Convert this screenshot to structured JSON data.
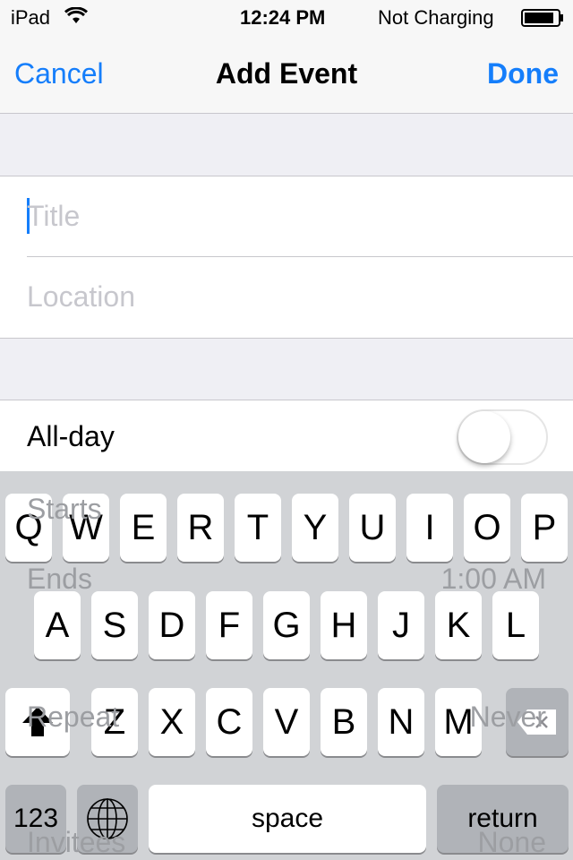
{
  "status": {
    "device": "iPad",
    "time": "12:24 PM",
    "battery": "Not Charging",
    "icons": [
      "wifi-icon",
      "battery-icon"
    ]
  },
  "nav": {
    "cancel": "Cancel",
    "title": "Add Event",
    "done": "Done"
  },
  "form": {
    "title_placeholder": "Title",
    "location_placeholder": "Location",
    "allday": "All-day",
    "allday_on": false,
    "starts": "Starts",
    "ends": "Ends",
    "ends_value": "1:00 AM",
    "repeat": "Repeat",
    "repeat_value": "Never",
    "invitees": "Invitees",
    "invitees_value": "None"
  },
  "keyboard": {
    "row1": [
      "Q",
      "W",
      "E",
      "R",
      "T",
      "Y",
      "U",
      "I",
      "O",
      "P"
    ],
    "row2": [
      "A",
      "S",
      "D",
      "F",
      "G",
      "H",
      "J",
      "K",
      "L"
    ],
    "row3": [
      "Z",
      "X",
      "C",
      "V",
      "B",
      "N",
      "M"
    ],
    "numbers": "123",
    "space": "space",
    "return": "return"
  },
  "colors": {
    "accent": "#157efb"
  }
}
